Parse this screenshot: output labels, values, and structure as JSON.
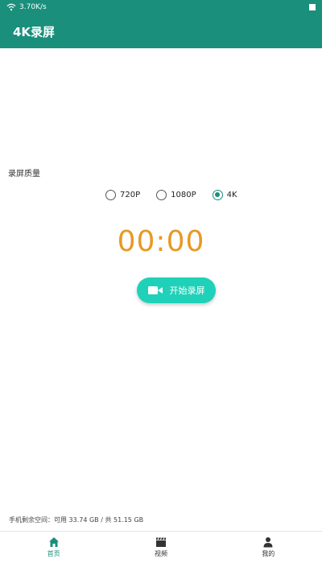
{
  "colors": {
    "primary": "#1a8f7c",
    "accent_button": "#1fd1b8",
    "timer": "#e69a24"
  },
  "status_bar": {
    "network_speed": "3.70K/s",
    "icons": [
      "wifi-icon",
      "battery-icon"
    ]
  },
  "app_bar": {
    "title": "4K录屏"
  },
  "quality": {
    "label": "录屏质量",
    "options": [
      {
        "label": "720P",
        "selected": false
      },
      {
        "label": "1080P",
        "selected": false
      },
      {
        "label": "4K",
        "selected": true
      }
    ]
  },
  "timer": {
    "value": "00:00"
  },
  "record_button": {
    "label": "开始录屏",
    "icon": "video-camera-icon"
  },
  "storage": {
    "text": "手机剩余空间：可用 33.74 GB / 共 51.15 GB"
  },
  "bottom_nav": {
    "items": [
      {
        "label": "首页",
        "icon": "home-icon",
        "active": true
      },
      {
        "label": "视频",
        "icon": "clapperboard-icon",
        "active": false
      },
      {
        "label": "我的",
        "icon": "person-icon",
        "active": false
      }
    ]
  }
}
